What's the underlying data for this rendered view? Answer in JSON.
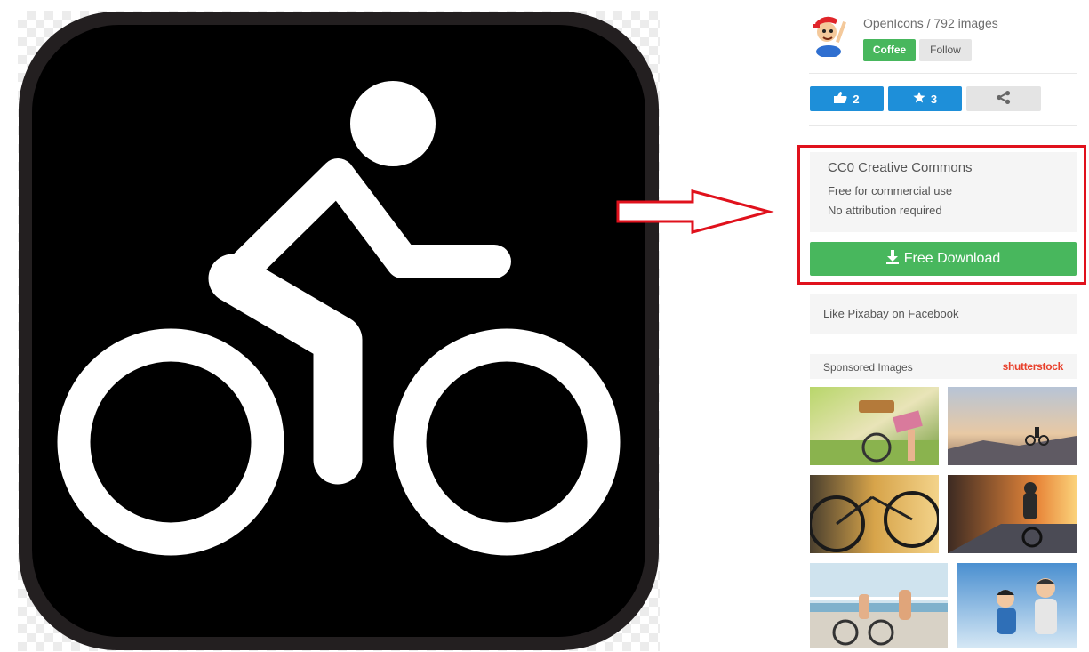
{
  "image": {
    "icon": "cyclist-pictogram-icon",
    "colors": {
      "background": "#000000",
      "frame": "#231f20",
      "figure": "#ffffff"
    }
  },
  "author": {
    "name": "OpenIcons / 792 images",
    "avatar_icon": "cartoon-avatar-icon",
    "coffee_label": "Coffee",
    "follow_label": "Follow"
  },
  "actions": {
    "like_count": "2",
    "like_icon": "thumbs-up-icon",
    "favorite_count": "3",
    "favorite_icon": "star-icon",
    "share_icon": "share-icon"
  },
  "license": {
    "title": "CC0 Creative Commons",
    "line1": "Free for commercial use",
    "line2": "No attribution required"
  },
  "download": {
    "label": "Free Download",
    "icon": "download-icon",
    "color": "#48b75d"
  },
  "facebook": {
    "label": "Like Pixabay on Facebook"
  },
  "sponsored": {
    "label": "Sponsored Images",
    "brand": "shutterstock",
    "thumbnails": [
      "cyclist-basket-photo",
      "mountain-biker-silhouette-photo",
      "bicycle-wheel-sunset-photo",
      "road-cyclist-sunset-photo",
      "couple-cycling-seaside-photo",
      "family-cycling-photo"
    ]
  },
  "annotation": {
    "color": "#e0111c"
  }
}
